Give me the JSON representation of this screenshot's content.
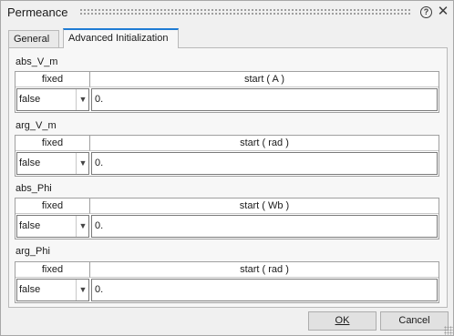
{
  "window": {
    "title": "Permeance"
  },
  "tabs": [
    {
      "label": "General"
    },
    {
      "label": "Advanced Initialization"
    }
  ],
  "groups": [
    {
      "label": "abs_V_m",
      "fixed_header": "fixed",
      "start_header": "start ( A )",
      "fixed_value": "false",
      "start_value": "0."
    },
    {
      "label": "arg_V_m",
      "fixed_header": "fixed",
      "start_header": "start ( rad )",
      "fixed_value": "false",
      "start_value": "0."
    },
    {
      "label": "abs_Phi",
      "fixed_header": "fixed",
      "start_header": "start ( Wb )",
      "fixed_value": "false",
      "start_value": "0."
    },
    {
      "label": "arg_Phi",
      "fixed_header": "fixed",
      "start_header": "start ( rad )",
      "fixed_value": "false",
      "start_value": "0."
    }
  ],
  "buttons": {
    "ok": "OK",
    "cancel": "Cancel"
  },
  "icons": {
    "help": "help-icon",
    "close": "close-icon",
    "dropdown": "chevron-down-icon"
  }
}
